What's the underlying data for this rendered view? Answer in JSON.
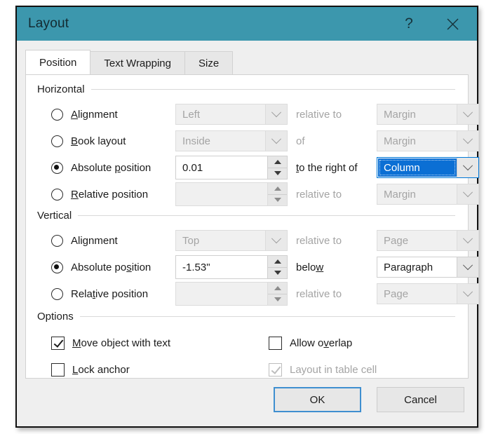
{
  "window": {
    "title": "Layout",
    "help_icon": "question-mark-icon",
    "close_icon": "close-icon",
    "titlebar_color": "#3c97ad"
  },
  "tabs": [
    {
      "label": "Position",
      "active": true
    },
    {
      "label": "Text Wrapping",
      "active": false
    },
    {
      "label": "Size",
      "active": false
    }
  ],
  "horizontal": {
    "group_label": "Horizontal",
    "rows": {
      "alignment": {
        "radio_label_pre": "",
        "radio_accel": "A",
        "radio_label_post": "lignment",
        "selected": false,
        "value": "Left",
        "mid_label": "relative to",
        "relative_to": "Margin",
        "enabled": false
      },
      "book_layout": {
        "radio_accel": "B",
        "radio_label_post": "ook layout",
        "selected": false,
        "value": "Inside",
        "mid_label": "of",
        "relative_to": "Margin",
        "enabled": false
      },
      "absolute_position": {
        "radio_label_pre": "Absolute ",
        "radio_accel": "p",
        "radio_label_post": "osition",
        "selected": true,
        "value": "0.01",
        "mid_label_pre": "",
        "mid_label_accel": "t",
        "mid_label_post": "o the right of",
        "relative_to": "Column",
        "enabled": true,
        "combo_focused": true
      },
      "relative_position": {
        "radio_accel": "R",
        "radio_label_post": "elative position",
        "selected": false,
        "value": "",
        "mid_label": "relative to",
        "relative_to": "Margin",
        "enabled": false
      }
    }
  },
  "vertical": {
    "group_label": "Vertical",
    "rows": {
      "alignment": {
        "radio_label_pre": "Ali",
        "radio_accel": "g",
        "radio_label_post": "nment",
        "selected": false,
        "value": "Top",
        "mid_label": "relative to",
        "relative_to": "Page",
        "enabled": false
      },
      "absolute_position": {
        "radio_label_pre": "Absolute po",
        "radio_accel": "s",
        "radio_label_post": "ition",
        "selected": true,
        "value": "-1.53\"",
        "mid_label_pre": "belo",
        "mid_label_accel": "w",
        "mid_label_post": "",
        "relative_to": "Paragraph",
        "enabled": true
      },
      "relative_position": {
        "radio_label_pre": "Rela",
        "radio_accel": "t",
        "radio_label_post": "ive position",
        "selected": false,
        "value": "",
        "mid_label": "relative to",
        "relative_to": "Page",
        "enabled": false
      }
    }
  },
  "options": {
    "group_label": "Options",
    "items": [
      {
        "label_pre": "",
        "accel": "M",
        "label_post": "ove object with text",
        "checked": true,
        "enabled": true
      },
      {
        "label_pre": "",
        "accel": "L",
        "label_post": "ock anchor",
        "checked": false,
        "enabled": true
      },
      {
        "label_pre": "Allow o",
        "accel": "v",
        "label_post": "erlap",
        "checked": false,
        "enabled": true
      },
      {
        "label_pre": "Layout in table cell",
        "accel": "",
        "label_post": "",
        "checked": true,
        "enabled": false
      }
    ]
  },
  "footer": {
    "ok_label": "OK",
    "cancel_label": "Cancel",
    "default_button_color": "#3f8fd0"
  }
}
